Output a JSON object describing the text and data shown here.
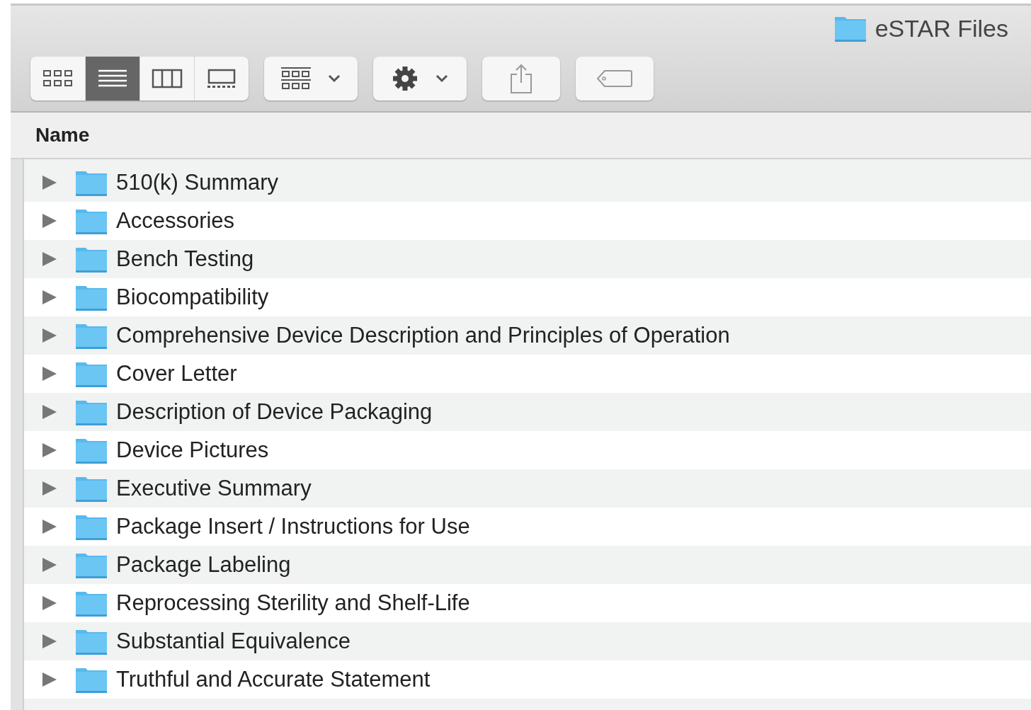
{
  "window": {
    "title": "eSTAR Files"
  },
  "toolbar": {
    "view_modes": [
      {
        "kind": "icons",
        "selected": false
      },
      {
        "kind": "list",
        "selected": true
      },
      {
        "kind": "columns",
        "selected": false
      },
      {
        "kind": "gallery",
        "selected": false
      }
    ],
    "buttons": [
      {
        "kind": "group"
      },
      {
        "kind": "action"
      },
      {
        "kind": "share"
      },
      {
        "kind": "tags"
      }
    ]
  },
  "columns": [
    "Name"
  ],
  "rows": [
    {
      "name": "510(k) Summary",
      "expanded": false
    },
    {
      "name": "Accessories",
      "expanded": false
    },
    {
      "name": "Bench Testing",
      "expanded": false
    },
    {
      "name": "Biocompatibility",
      "expanded": false
    },
    {
      "name": "Comprehensive Device Description and Principles of Operation",
      "expanded": false
    },
    {
      "name": "Cover Letter",
      "expanded": false
    },
    {
      "name": "Description of Device Packaging",
      "expanded": false
    },
    {
      "name": "Device Pictures",
      "expanded": false
    },
    {
      "name": "Executive Summary",
      "expanded": false
    },
    {
      "name": "Package Insert / Instructions for Use",
      "expanded": false
    },
    {
      "name": "Package Labeling",
      "expanded": false
    },
    {
      "name": "Reprocessing Sterility and Shelf-Life",
      "expanded": false
    },
    {
      "name": "Substantial Equivalence",
      "expanded": false
    },
    {
      "name": "Truthful and Accurate Statement",
      "expanded": false
    }
  ]
}
